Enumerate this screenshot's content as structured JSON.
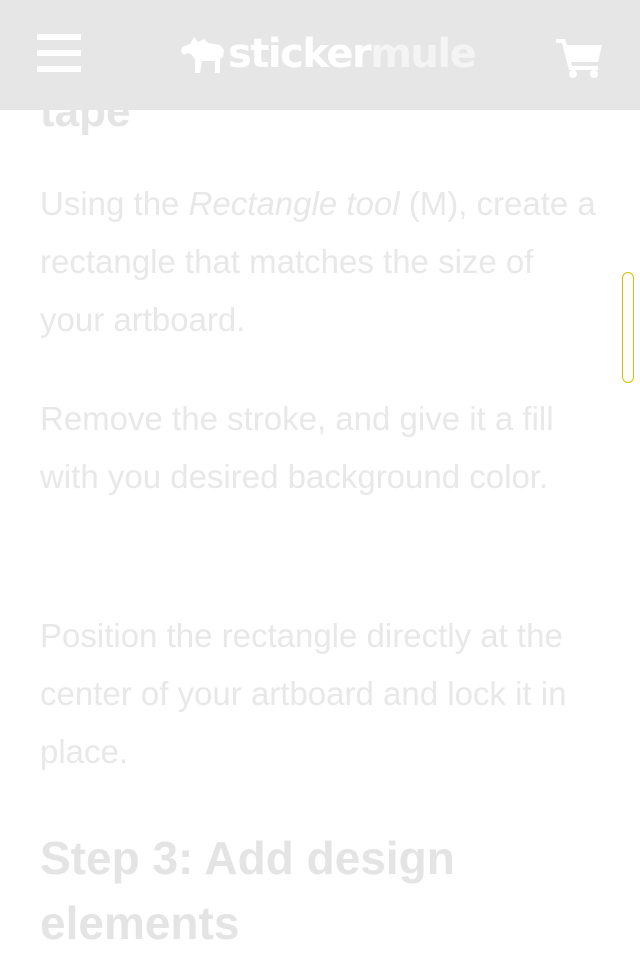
{
  "header": {
    "logo": {
      "part1": "sticker",
      "part2": "mule"
    },
    "icons": {
      "menu": "hamburger-menu-icon",
      "logo_mark": "mule-icon",
      "cart": "shopping-cart-icon"
    }
  },
  "article": {
    "partial_heading": "tape",
    "paragraph1": {
      "before": "Using the ",
      "italic": "Rectangle tool",
      "after": " (M), create a rectangle that matches the size of your artboard."
    },
    "paragraph2": "Remove the stroke, and give it a fill with you desired background color.",
    "paragraph3": "Position the rectangle directly at the center of your artboard and lock it in place.",
    "step_heading": "Step 3: Add design elements"
  },
  "colors": {
    "header_bg": "#e6e6e6",
    "text": "#e8e8e8",
    "scrollbar_outline": "#d8c000"
  }
}
